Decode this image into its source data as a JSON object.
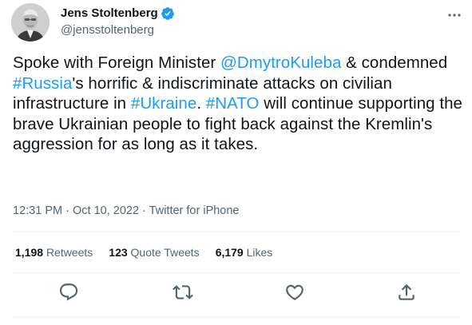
{
  "author": {
    "display_name": "Jens Stoltenberg",
    "handle": "@jensstoltenberg",
    "verified": true
  },
  "tweet": {
    "segments": [
      {
        "text": "Spoke with Foreign Minister ",
        "link": false
      },
      {
        "text": "@DmytroKuleba",
        "link": true
      },
      {
        "text": " & condemned ",
        "link": false
      },
      {
        "text": "#Russia",
        "link": true
      },
      {
        "text": "'s horrific & indiscriminate attacks on civilian infrastructure in ",
        "link": false
      },
      {
        "text": "#Ukraine",
        "link": true
      },
      {
        "text": ". ",
        "link": false
      },
      {
        "text": "#NATO",
        "link": true
      },
      {
        "text": " will continue supporting the brave Ukrainian people to fight back against the Kremlin's aggression for as long as it takes.",
        "link": false
      }
    ],
    "time": "12:31 PM",
    "separator": "·",
    "date": "Oct 10, 2022",
    "source": "Twitter for iPhone"
  },
  "stats": {
    "retweets_count": "1,198",
    "retweets_label": "Retweets",
    "quotes_count": "123",
    "quotes_label": "Quote Tweets",
    "likes_count": "6,179",
    "likes_label": "Likes"
  },
  "actions": [
    "reply-icon",
    "retweet-icon",
    "like-icon",
    "share-icon"
  ],
  "colors": {
    "link": "#1d9bf0",
    "text": "#0f1419",
    "secondary": "#536471",
    "divider": "#eff3f4"
  }
}
